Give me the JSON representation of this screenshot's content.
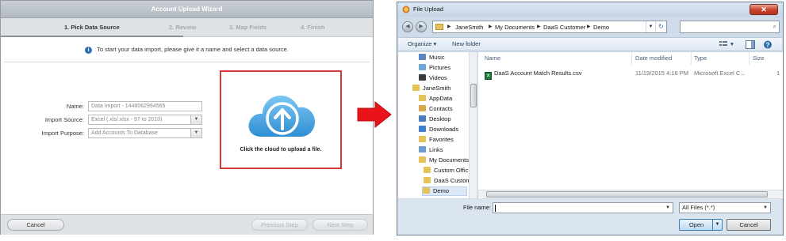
{
  "wizard": {
    "title": "Account Upload Wizard",
    "steps": [
      "1. Pick Data Source",
      "2. Review",
      "3. Map Fields",
      "4. Finish"
    ],
    "info_text": "To start your data import, please give it a name and select a data source.",
    "form": {
      "name_label": "Name:",
      "name_value": "Data Import - 1448062994565",
      "source_label": "Import Source:",
      "source_value": "Excel (.xls/.xlsx - 97 to 2010)",
      "purpose_label": "Import Purpose:",
      "purpose_value": "Add Accounts To Database"
    },
    "upload_text": "Click the cloud to upload a file.",
    "buttons": {
      "cancel": "Cancel",
      "previous": "Previous Step",
      "next": "Next Step"
    }
  },
  "dialog": {
    "title": "File Upload",
    "breadcrumbs": [
      "JaneSmith",
      "My Documents",
      "DaaS Customer",
      "Demo"
    ],
    "toolbar": {
      "organize": "Organize",
      "new_folder": "New folder"
    },
    "nav_items": [
      "Music",
      "Pictures",
      "Videos",
      "JaneSmith",
      "AppData",
      "Contacts",
      "Desktop",
      "Downloads",
      "Favorites",
      "Links",
      "My Documents",
      "Custom Offic",
      "DaaS Custom",
      "Demo"
    ],
    "columns": [
      "Name",
      "Date modified",
      "Type",
      "Size"
    ],
    "files": [
      {
        "name": "DaaS Account Match Results.csv",
        "date": "11/19/2015 4:16 PM",
        "type": "Microsoft Excel C...",
        "size": "1"
      }
    ],
    "file_name_label": "File name:",
    "file_name_value": "",
    "filter": "All Files (*.*)",
    "open_label": "Open",
    "cancel_label": "Cancel"
  },
  "colors": {
    "highlight_border": "#d43a3a",
    "cloud_blue": "#4aa3df",
    "arrow_red": "#e8141a"
  }
}
